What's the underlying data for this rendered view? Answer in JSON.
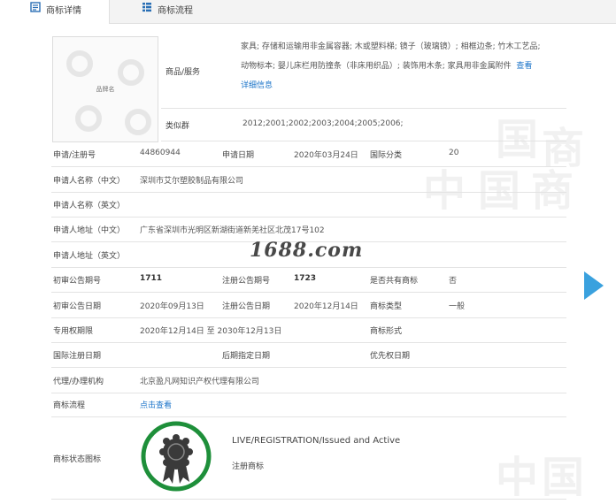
{
  "tabs": [
    {
      "label": "商标详情",
      "active": true
    },
    {
      "label": "商标流程",
      "active": false
    }
  ],
  "thumbnail": {
    "text": "品牌名"
  },
  "watermark_site": "1688.com",
  "goods": {
    "label": "商品/服务",
    "line1": "家具; 存储和运输用非金属容器; 木或塑料梯; 镜子（玻璃镜）; 相框边条; 竹木工艺品;",
    "line2_text": "动物标本; 婴儿床栏用防撞条（非床用织品）; 装饰用木条; 家具用非金属附件",
    "line2_link": "查看",
    "line3_link": "详细信息"
  },
  "similar_groups": {
    "label": "类似群",
    "value": "2012;2001;2002;2003;2004;2005;2006;"
  },
  "rows": {
    "reg_no_label": "申请/注册号",
    "reg_no": "44860944",
    "app_date_label": "申请日期",
    "app_date": "2020年03月24日",
    "intl_class_label": "国际分类",
    "intl_class": "20",
    "applicant_cn_label": "申请人名称（中文）",
    "applicant_cn": "深圳市艾尔塑胶制品有限公司",
    "applicant_en_label": "申请人名称（英文）",
    "address_cn_label": "申请人地址（中文）",
    "address_cn": "广东省深圳市光明区新湖街道新羌社区北茂17号102",
    "address_en_label": "申请人地址（英文）",
    "prelim_no_label": "初审公告期号",
    "prelim_no": "1711",
    "reg_pub_no_label": "注册公告期号",
    "reg_pub_no": "1723",
    "shared_label": "是否共有商标",
    "shared": "否",
    "prelim_date_label": "初审公告日期",
    "prelim_date": "2020年09月13日",
    "reg_pub_date_label": "注册公告日期",
    "reg_pub_date": "2020年12月14日",
    "tm_type_label": "商标类型",
    "tm_type": "一般",
    "excl_period_label": "专用权期限",
    "excl_period": "2020年12月14日 至 2030年12月13日",
    "tm_form_label": "商标形式",
    "intl_reg_date_label": "国际注册日期",
    "later_date_label": "后期指定日期",
    "priority_date_label": "优先权日期",
    "agent_label": "代理/办理机构",
    "agent": "北京盈凡网知识产权代理有限公司",
    "flow_label": "商标流程",
    "flow_link": "点击查看",
    "status_icon_label": "商标状态图标",
    "status_en": "LIVE/REGISTRATION/Issued and Active",
    "status_cn": "注册商标"
  },
  "colors": {
    "accent": "#1a73c8",
    "badge": "#1e8f3a",
    "arrow": "#3aa1de"
  },
  "icons": [
    "document-icon",
    "list-icon",
    "award-ribbon-icon",
    "next-arrow-icon"
  ]
}
